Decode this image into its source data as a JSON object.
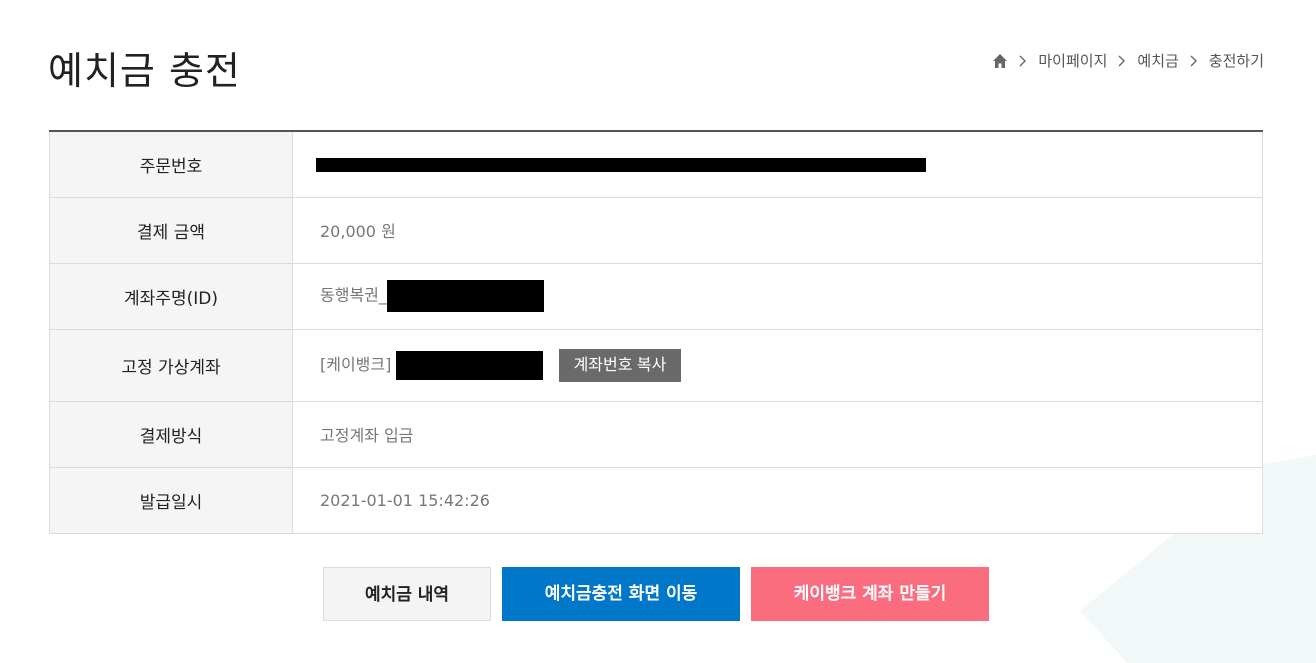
{
  "page": {
    "title": "예치금 충전"
  },
  "breadcrumb": {
    "home_icon": "home-icon",
    "items": [
      "마이페이지",
      "예치금",
      "충전하기"
    ]
  },
  "table": {
    "rows": [
      {
        "label": "주문번호",
        "value": ""
      },
      {
        "label": "결제 금액",
        "value": "20,000 원"
      },
      {
        "label": "계좌주명(ID)",
        "value": "동행복권_"
      },
      {
        "label": "고정 가상계좌",
        "value": "[케이뱅크]"
      },
      {
        "label": "결제방식",
        "value": "고정계좌 입금"
      },
      {
        "label": "발급일시",
        "value": "2021-01-01 15:42:26"
      }
    ],
    "copy_button_label": "계좌번호 복사"
  },
  "actions": {
    "history_label": "예치금 내역",
    "charge_label": "예치금충전 화면 이동",
    "kbank_label": "케이뱅크 계좌 만들기"
  },
  "colors": {
    "amount": "#c0462b",
    "primary_button": "#0077c8",
    "kbank_button": "#f96d7f",
    "copy_button": "#6a6a6a"
  }
}
